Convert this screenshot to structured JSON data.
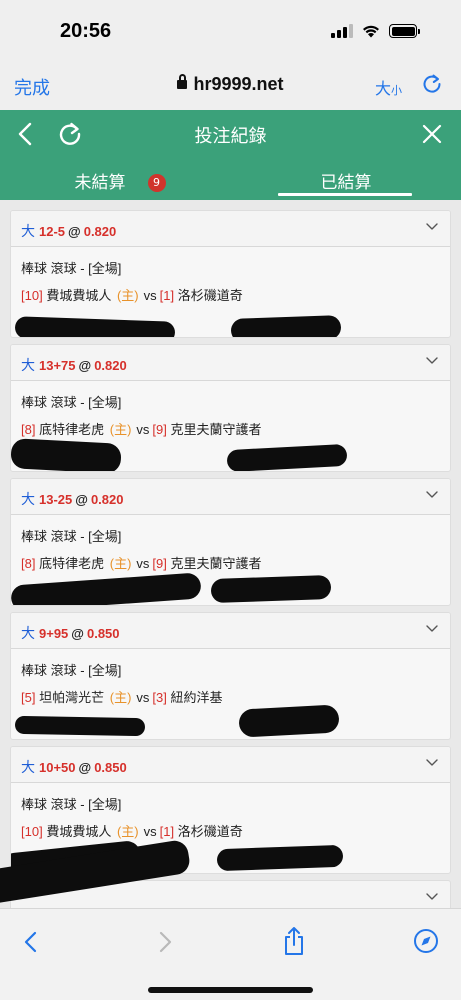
{
  "status_bar": {
    "time": "20:56"
  },
  "browser": {
    "done_label": "完成",
    "url": "hr9999.net",
    "text_size_big": "大",
    "text_size_small": "小"
  },
  "header": {
    "title": "投注紀錄"
  },
  "tabs": {
    "unsettled_label": "未結算",
    "unsettled_count": "9",
    "settled_label": "已結算"
  },
  "bets": [
    {
      "type": "大",
      "line": "12-5",
      "at": "@",
      "odds": "0.820",
      "sport": "棒球 滾球 - [全場]",
      "home_no": "[10]",
      "home": "費城費城人",
      "home_tag": "(主)",
      "vs": "vs",
      "away_no": "[1]",
      "away": "洛杉磯道奇"
    },
    {
      "type": "大",
      "line": "13+75",
      "at": "@",
      "odds": "0.820",
      "sport": "棒球 滾球 - [全場]",
      "home_no": "[8]",
      "home": "底特律老虎",
      "home_tag": "(主)",
      "vs": "vs",
      "away_no": "[9]",
      "away": "克里夫蘭守護者"
    },
    {
      "type": "大",
      "line": "13-25",
      "at": "@",
      "odds": "0.820",
      "sport": "棒球 滾球 - [全場]",
      "home_no": "[8]",
      "home": "底特律老虎",
      "home_tag": "(主)",
      "vs": "vs",
      "away_no": "[9]",
      "away": "克里夫蘭守護者"
    },
    {
      "type": "大",
      "line": "9+95",
      "at": "@",
      "odds": "0.850",
      "sport": "棒球 滾球 - [全場]",
      "home_no": "[5]",
      "home": "坦帕灣光芒",
      "home_tag": "(主)",
      "vs": "vs",
      "away_no": "[3]",
      "away": "紐約洋基"
    },
    {
      "type": "大",
      "line": "10+50",
      "at": "@",
      "odds": "0.850",
      "sport": "棒球 滾球 - [全場]",
      "home_no": "[10]",
      "home": "費城費城人",
      "home_tag": "(主)",
      "vs": "vs",
      "away_no": "[1]",
      "away": "洛杉磯道奇"
    }
  ],
  "icons": {
    "lock": "lock-icon",
    "reload": "reload-icon",
    "back": "chevron-left-icon",
    "refresh": "refresh-icon",
    "close": "close-icon",
    "expand": "chevron-down-icon",
    "share": "share-icon",
    "safari": "compass-icon"
  },
  "colors": {
    "header_green": "#3ba17a",
    "link_blue": "#2476e8",
    "odds_red": "#d6302b",
    "home_orange": "#e8922a",
    "badge_red": "#d0342c"
  }
}
